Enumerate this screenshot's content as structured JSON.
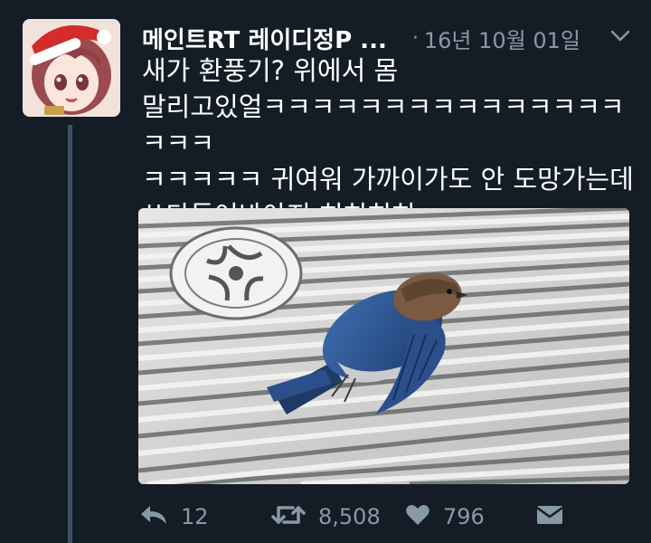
{
  "tweet": {
    "display_name": "메인트RT 레이디정P ...",
    "time": "16년 10월 01일",
    "text": "새가 환풍기? 위에서 몸\n말리고있얼ㅋㅋㅋㅋㅋㅋㅋㅋㅋㅋㅋㅋㅋㅋㅋㅋㅋㅋ\nㅋㅋㅋㅋㅋ 귀여워 가까이가도 안 도망가는데\n쓰다듬어봐야지 히히히히"
  },
  "actions": {
    "reply_count": "12",
    "retweet_count": "8,508",
    "like_count": "796"
  },
  "colors": {
    "background": "#141d26",
    "secondary_text": "#8899a6",
    "thread_line": "#3d5063"
  },
  "icons": [
    "reply-icon",
    "retweet-icon",
    "heart-icon",
    "mail-icon",
    "chevron-down-icon"
  ]
}
